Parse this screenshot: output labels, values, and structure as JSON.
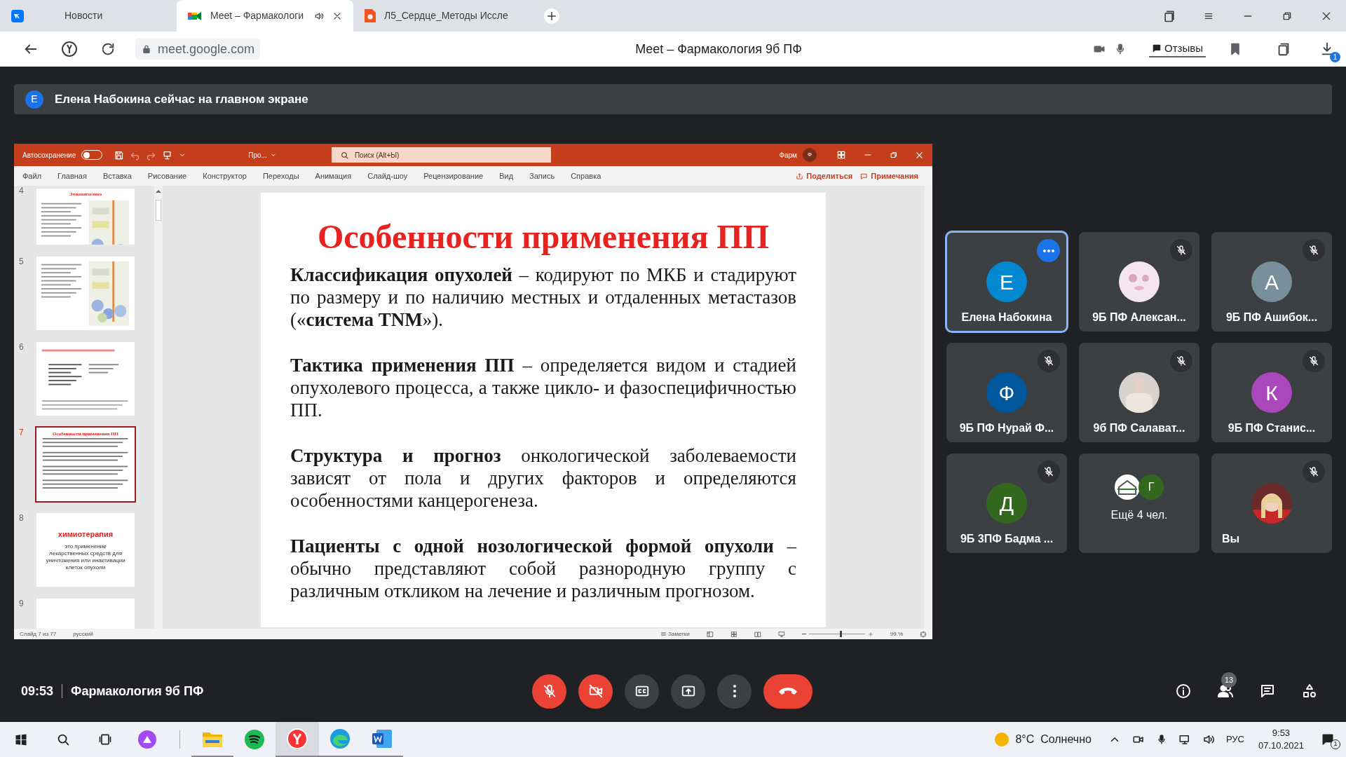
{
  "browser": {
    "tabs": [
      {
        "title": "Новости",
        "selected": false,
        "playing_audio": false
      },
      {
        "title": "Meet – Фармакологи",
        "selected": true,
        "playing_audio": true
      },
      {
        "title": "Л5_Сердце_Методы Иссле",
        "selected": false,
        "playing_audio": false
      }
    ],
    "url": "meet.google.com",
    "page_title": "Meet – Фармакология 9б ПФ",
    "feedback_label": "Отзывы",
    "downloads_badge": "1"
  },
  "banner": {
    "avatar": "Е",
    "text": "Елена Набокина сейчас на главном экране"
  },
  "presentation": {
    "autosave_label": "Автосохранение",
    "autosave_on": false,
    "file_name": "Про...",
    "search_placeholder": "Поиск (Alt+Ы)",
    "user_label": "Фарм",
    "user_initial": "Ф",
    "ribbon_tabs": [
      "Файл",
      "Главная",
      "Вставка",
      "Рисование",
      "Конструктор",
      "Переходы",
      "Анимация",
      "Слайд-шоу",
      "Рецензирование",
      "Вид",
      "Запись",
      "Справка"
    ],
    "share_label": "Поделиться",
    "comments_label": "Примечания",
    "thumbnails": [
      {
        "number": "4",
        "kind": "diagram",
        "title": "Этиопатогенез",
        "selected": false
      },
      {
        "number": "5",
        "kind": "diagram",
        "selected": false
      },
      {
        "number": "6",
        "kind": "list",
        "selected": false
      },
      {
        "number": "7",
        "kind": "text",
        "title": "Особенности применения ПП",
        "selected": true
      },
      {
        "number": "8",
        "kind": "title",
        "title": "химиотерапия",
        "text": "это применение лекарственных средств для уничтожения или инактивации клеток опухоли",
        "selected": false
      },
      {
        "number": "9",
        "kind": "blank",
        "selected": false
      }
    ],
    "slide": {
      "title": "Особенности применения ПП",
      "paragraphs": [
        "**Классификация опухолей** – кодируют по МКБ и стадируют по размеру и по наличию местных и отдаленных метастазов («**система TNM**»).",
        "**Тактика применения ПП** – определяется видом и стадией опухолевого процесса, а также цикло- и фазоспецифичностью ПП.",
        "**Структура и прогноз** онкологической заболеваемости зависят от пола и других факторов и определяются особенностями канцерогенеза.",
        "**Пациенты с одной нозологической формой опухоли** – обычно представляют собой разнородную группу с различным откликом на лечение и различным прогнозом."
      ]
    },
    "status": {
      "slide_counter": "Слайд 7 из 77",
      "language": "русский",
      "notes_label": "Заметки",
      "zoom": "99 %",
      "zoom_slider": {
        "level": 0.55
      }
    }
  },
  "participants": [
    {
      "name": "Елена Набокина",
      "kind": "letter",
      "initial": "Е",
      "color": "#0288d1",
      "muted": false,
      "highlighted": true
    },
    {
      "name": "9Б ПФ Алексан...",
      "muted": true,
      "highlighted": false
    },
    {
      "name": "9Б ПФ Ашибок...",
      "kind": "letter",
      "initial": "А",
      "color": "#78909c",
      "muted": true,
      "highlighted": false
    },
    {
      "name": "9Б ПФ Нурай Ф...",
      "kind": "letter",
      "initial": "Ф",
      "color": "#01579b",
      "muted": true,
      "highlighted": false
    },
    {
      "name": "9б ПФ Салават...",
      "muted": true,
      "highlighted": false
    },
    {
      "name": "9Б ПФ Станис...",
      "kind": "letter",
      "initial": "К",
      "color": "#ab47bc",
      "muted": true,
      "highlighted": false
    },
    {
      "name": "9Б 3ПФ Бадма ...",
      "kind": "letter",
      "initial": "Д",
      "color": "#33691e",
      "muted": true,
      "highlighted": false
    },
    {
      "name": "Ещё 4 чел.",
      "kind": "group",
      "initial": "Г",
      "color": "#33691e",
      "muted": false,
      "highlighted": false
    },
    {
      "name": "Вы",
      "muted": true,
      "highlighted": false
    }
  ],
  "meeting": {
    "time": "09:53",
    "title": "Фармакология 9б ПФ",
    "mic_on": false,
    "camera_on": false,
    "people_count": "13"
  },
  "taskbar": {
    "weather": "8°C  Солнечно",
    "language": "РУС",
    "time": "9:53",
    "date": "07.10.2021",
    "notifications": "1"
  }
}
